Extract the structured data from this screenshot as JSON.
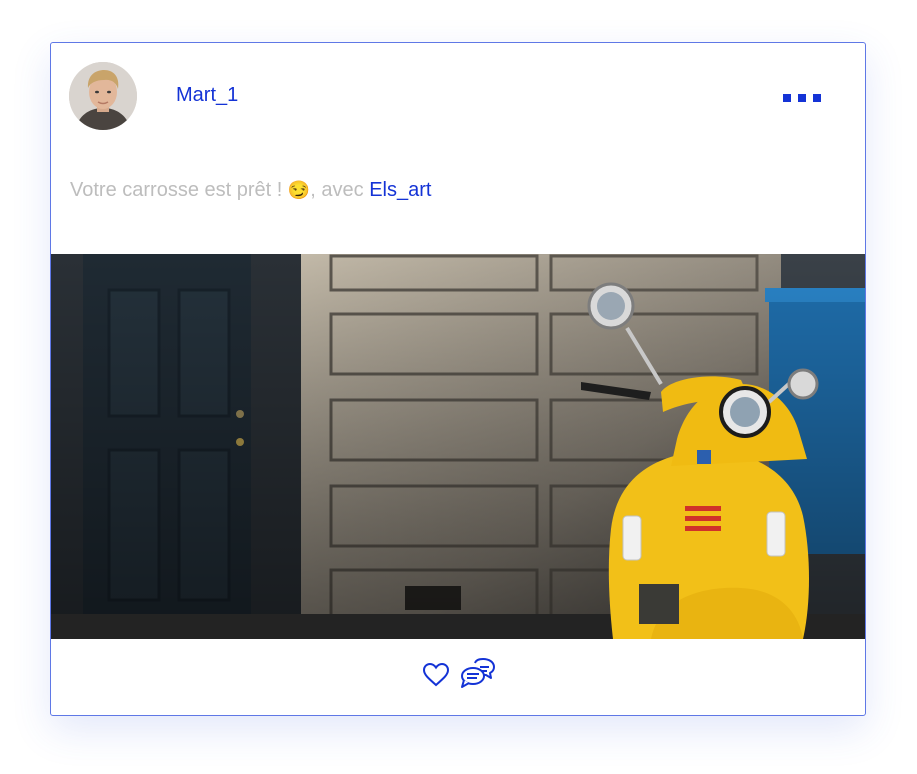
{
  "post": {
    "author": {
      "username": "Mart_1",
      "avatar": "avatar-photo"
    },
    "menu_icon": "more-horizontal-icon",
    "caption": {
      "text": "Votre carrosse est prêt ! ",
      "emoji": "😏",
      "connector": ", avec ",
      "mention": "Els_art"
    },
    "image": "yellow-scooter-photo",
    "actions": {
      "like_icon": "heart-icon",
      "comment_icon": "comments-icon"
    }
  },
  "colors": {
    "accent": "#1433d6",
    "border": "#5f78e6",
    "caption": "#bdbdbd",
    "scooter": "#f2c018"
  }
}
